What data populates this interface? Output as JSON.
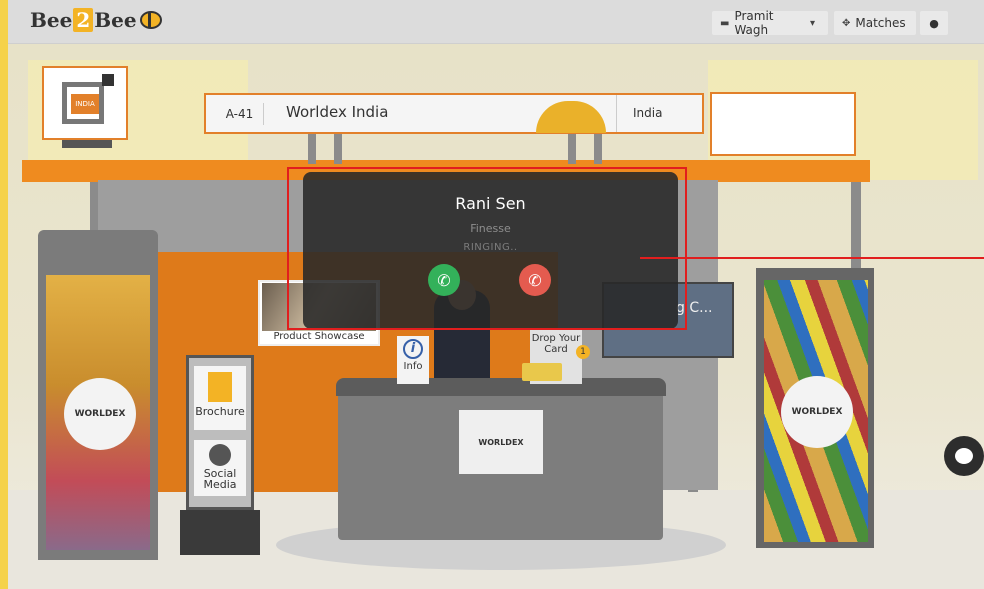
{
  "header": {
    "logo": {
      "part1": "Bee",
      "part2": "2",
      "part3": "Bee"
    },
    "user_menu_label": "Pramit Wagh",
    "matches_label": "Matches"
  },
  "booth": {
    "code": "A-41",
    "company": "Worldex India",
    "country": "India",
    "logo_label": "INDIA",
    "brand": "WORLDEX"
  },
  "stand": {
    "brochure_label": "Brochure",
    "social_label": "Social Media"
  },
  "desk": {
    "info_label": "Info",
    "drop_card_label": "Drop Your Card",
    "drop_card_count": "1"
  },
  "showcase": {
    "label": "Product Showcase"
  },
  "video": {
    "title": "g C..."
  },
  "call": {
    "name": "Rani Sen",
    "company": "Finesse",
    "status": "RINGING.."
  },
  "icons": {
    "accept": "phone-accept-icon",
    "decline": "phone-decline-icon",
    "chat": "chat-icon"
  },
  "colors": {
    "accent": "#f3b325",
    "booth_orange": "#ef8b1f",
    "accept_green": "#33b15a",
    "decline_red": "#e45b4f",
    "highlight_red": "#e11e1e"
  }
}
